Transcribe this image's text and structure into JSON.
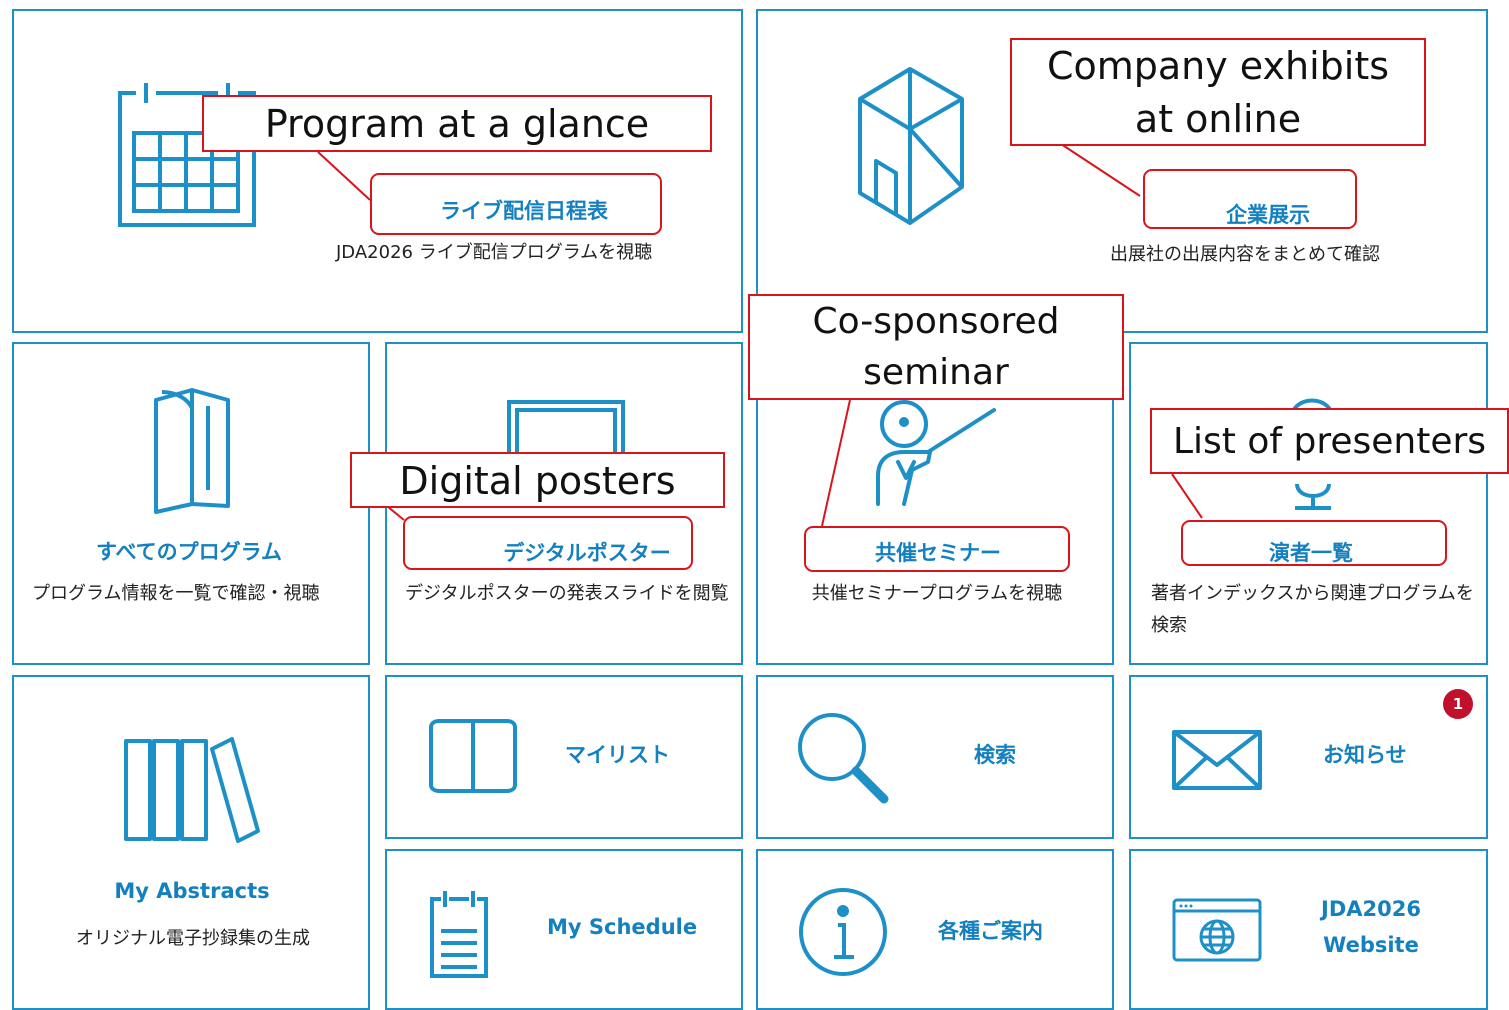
{
  "colors": {
    "accent": "#1e90c8",
    "title": "#1480c0",
    "annotation": "#d9141b",
    "badge": "#c0102c"
  },
  "tiles": {
    "live": {
      "title": "ライブ配信日程表",
      "desc": "JDA2026 ライブ配信プログラムを視聴",
      "icon": "calendar-icon"
    },
    "exhibits": {
      "title": "企業展示",
      "desc": "出展社の出展内容をまとめて確認",
      "icon": "cube-icon"
    },
    "all_programs": {
      "title": "すべてのプログラム",
      "desc": "プログラム情報を一覧で確認・視聴",
      "icon": "booklet-icon"
    },
    "posters": {
      "title": "デジタルポスター",
      "desc": "デジタルポスターの発表スライドを閲覧",
      "icon": "poster-icon"
    },
    "seminar": {
      "title": "共催セミナー",
      "desc": "共催セミナープログラムを視聴",
      "icon": "presenter-icon"
    },
    "presenters": {
      "title": "演者一覧",
      "desc": "著者インデックスから関連プログラムを検索",
      "icon": "speaker-icon"
    },
    "my_abstracts": {
      "title": "My Abstracts",
      "desc": "オリジナル電子抄録集の生成",
      "icon": "books-icon"
    },
    "mylist": {
      "title": "マイリスト",
      "icon": "open-book-icon"
    },
    "search": {
      "title": "検索",
      "icon": "magnifier-icon"
    },
    "news": {
      "title": "お知らせ",
      "icon": "envelope-icon",
      "badge": "1"
    },
    "schedule": {
      "title": "My Schedule",
      "icon": "schedule-icon"
    },
    "info": {
      "title": "各種ご案内",
      "icon": "info-icon"
    },
    "website": {
      "title_line1": "JDA2026",
      "title_line2": "Website",
      "icon": "browser-globe-icon"
    }
  },
  "annotations": {
    "program": "Program at a glance",
    "company_line1": "Company exhibits",
    "company_line2": "at online",
    "seminar_line1": "Co-sponsored",
    "seminar_line2": "seminar",
    "posters": "Digital posters",
    "presenters": "List of presenters"
  }
}
